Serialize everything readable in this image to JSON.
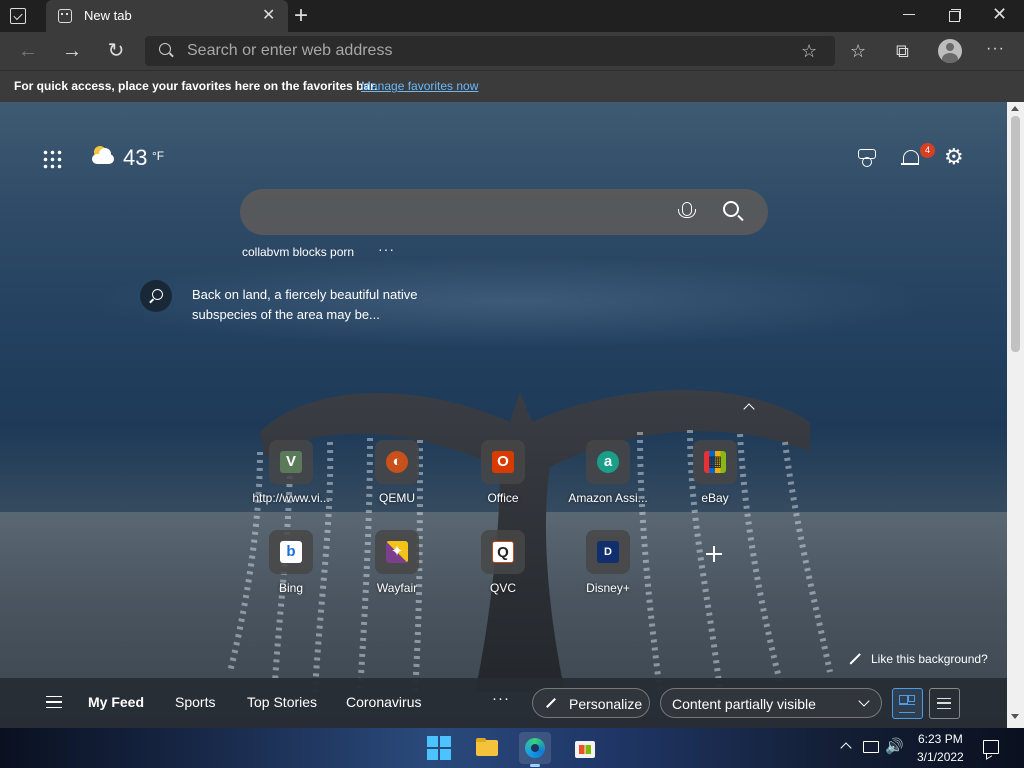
{
  "browser": {
    "tab_title": "New tab",
    "tab_close": "✕",
    "new_tab": "+",
    "window_close": "✕",
    "nav": {
      "back": "←",
      "forward": "→",
      "reload": "↻"
    },
    "omnibox_placeholder": "Search or enter web address",
    "toolbar_icons": {
      "favorites": "☆",
      "collections": "⧉",
      "menu": "···",
      "add_favorite": "☆"
    }
  },
  "favorites_bar": {
    "text": "For quick access, place your favorites here on the favorites bar.",
    "link": "Manage favorites now"
  },
  "ntp": {
    "weather": {
      "temp": "43",
      "unit": "°F"
    },
    "notification_count": "4",
    "settings_icon": "⚙",
    "trending_term": "collabvm blocks porn",
    "trending_more": "···",
    "info_text": "Back on land, a fiercely beautiful native subspecies of the area may be...",
    "like_background": "Like this background?",
    "quick_links": [
      {
        "label": "http://www.vi...",
        "logo": "V",
        "logo_bg": "#5a7a5a"
      },
      {
        "label": "QEMU",
        "logo": "◐",
        "logo_bg": "#c8501a"
      },
      {
        "label": "Office",
        "logo": "O",
        "logo_bg": "#d83b01"
      },
      {
        "label": "Amazon Assi...",
        "logo": "a",
        "logo_bg": "#1a9e8a"
      },
      {
        "label": "eBay",
        "logo": "▦",
        "logo_bg": "#2a2a2a"
      },
      {
        "label": "Bing",
        "logo": "b",
        "logo_bg": "#ffffff"
      },
      {
        "label": "Wayfair",
        "logo": "✦",
        "logo_bg": "#7b3f8c"
      },
      {
        "label": "QVC",
        "logo": "Q",
        "logo_bg": "#ffffff"
      },
      {
        "label": "Disney+",
        "logo": "D",
        "logo_bg": "#112e6e"
      }
    ]
  },
  "feed": {
    "tabs": [
      "My Feed",
      "Sports",
      "Top Stories",
      "Coronavirus"
    ],
    "more": "···",
    "personalize": "Personalize",
    "visibility": "Content partially visible"
  },
  "taskbar": {
    "time": "6:23 PM",
    "date": "3/1/2022",
    "volume_icon": "🔊"
  },
  "colors": {
    "accent": "#4a9ee8",
    "badge": "#d54024",
    "link": "#6cb8f6"
  }
}
